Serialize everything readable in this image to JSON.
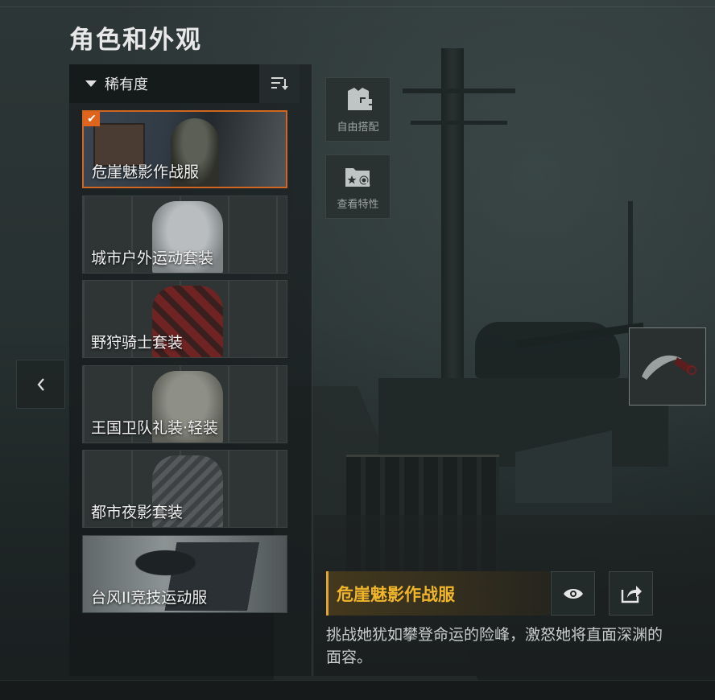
{
  "page": {
    "title": "角色和外观"
  },
  "filter": {
    "label": "稀有度",
    "sort_icon": "sort-icon"
  },
  "outfits": [
    {
      "name": "危崖魅影作战服",
      "selected": true
    },
    {
      "name": "城市户外运动套装",
      "selected": false
    },
    {
      "name": "野狩骑士套装",
      "selected": false
    },
    {
      "name": "王国卫队礼装·轻装",
      "selected": false
    },
    {
      "name": "都市夜影套装",
      "selected": false
    },
    {
      "name": "台风II竞技运动服",
      "selected": false
    }
  ],
  "side_buttons": {
    "free_match": "自由搭配",
    "view_traits": "查看特性"
  },
  "detail": {
    "title": "危崖魅影作战服",
    "description": "挑战她犹如攀登命运的险峰，激怒她将直面深渊的面容。"
  },
  "colors": {
    "accent": "#e0641c",
    "highlight": "#f0b52a"
  }
}
